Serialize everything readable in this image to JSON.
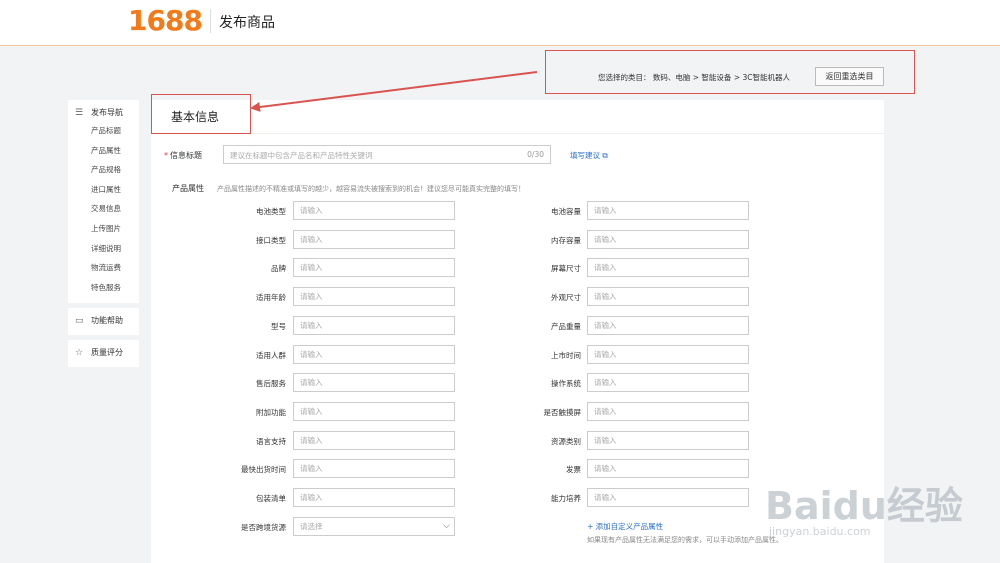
{
  "header": {
    "logo": "1688",
    "title": "发布商品"
  },
  "category": {
    "text": "您选择的类目： 数码、电脑 > 智能设备 > 3C智能机器人",
    "reselect": "返回重选类目"
  },
  "sidebar": {
    "nav_title": "发布导航",
    "items": [
      "产品标题",
      "产品属性",
      "产品规格",
      "进口属性",
      "交易信息",
      "上传图片",
      "详细说明",
      "物流运费",
      "特色服务"
    ],
    "help": "功能帮助",
    "quality": "质量评分"
  },
  "section": {
    "title": "基本信息"
  },
  "info_title": {
    "required": "*",
    "label": "信息标题",
    "placeholder": "建议在标题中包含产品名和产品特性关键词",
    "count": "0/30",
    "tip": "填写建议"
  },
  "attributes": {
    "label": "产品属性",
    "hint": "产品属性描述的不精准或填写的越少，越容易流失被搜索到的机会！建议您尽可能真实完整的填写！",
    "placeholder": "请输入",
    "select_placeholder": "请选择",
    "left": [
      "电池类型",
      "接口类型",
      "品牌",
      "适用年龄",
      "型号",
      "适用人群",
      "售后服务",
      "附加功能",
      "语言支持",
      "最快出货时间",
      "包装清单",
      "是否跨境货源"
    ],
    "right": [
      "电池容量",
      "内存容量",
      "屏幕尺寸",
      "外观尺寸",
      "产品重量",
      "上市时间",
      "操作系统",
      "是否触摸屏",
      "资源类别",
      "发票",
      "能力培养"
    ],
    "add_custom": "+ 添加自定义产品属性",
    "add_hint": "如果现有产品属性无法满足您的需求，可以手动添加产品属性。"
  },
  "watermark": {
    "main": "Baidu经验",
    "sub": "jingyan.baidu.com"
  },
  "colors": {
    "brand": "#f27a18",
    "link": "#2a6fc9",
    "annotation": "#d9534f"
  }
}
